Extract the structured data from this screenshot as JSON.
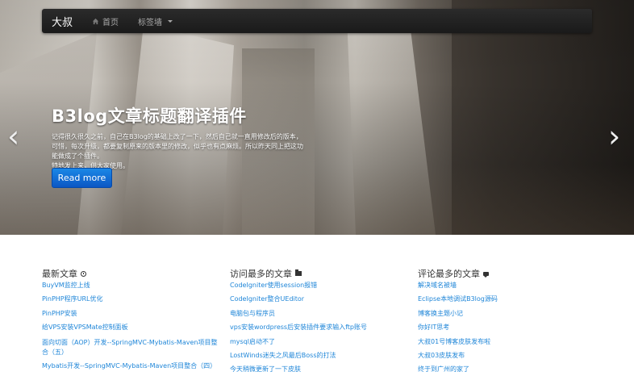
{
  "navbar": {
    "brand": "大叔",
    "items": [
      {
        "label": "首页",
        "icon": "home-icon"
      },
      {
        "label": "标签墙",
        "icon": "chevron-down-icon"
      }
    ]
  },
  "carousel": {
    "title": "B3log文章标题翻译插件",
    "description_lines": [
      "记得很久很久之前，自己在B3log的基础上改了一下，然后自己就一直用修改后的版本，",
      "可惜，每次升级，都要复制原来的版本里的修改，似乎也有点麻烦。所以昨天同上把这功",
      "能做成了个插件。",
      "特地发上来，供大家使用。"
    ],
    "read_more": "Read more",
    "prev": "‹",
    "next": "›"
  },
  "latest": {
    "heading": "最新文章",
    "items": [
      "BuyVM监控上线",
      "PinPHP程序URL优化",
      "PinPHP安装",
      "给VPS安装VPSMate控制面板",
      "面向切面（AOP）开发--SpringMVC-Mybatis-Maven项目整合（五）",
      "Mybatis开发--SpringMVC-Mybatis-Maven项目整合（四）"
    ]
  },
  "most_visited": {
    "heading": "访问最多的文章",
    "items": [
      "CodeIgniter使用session报错",
      "CodeIgniter整合UEditor",
      "电脑包与程序员",
      "vps安装wordpress后安装插件要求输入ftp账号",
      "mysql启动不了",
      "LostWinds迷失之风最后Boss的打法",
      "今天稍微更新了一下皮肤"
    ]
  },
  "most_commented": {
    "heading": "评论最多的文章",
    "items": [
      "解决域名被墙",
      "Eclipse本地调试B3log源码",
      "博客换主题小记",
      "你好IT思考",
      "大叔01号博客皮肤发布啦",
      "大叔03皮肤发布",
      "终于到广州的家了"
    ]
  },
  "colors": {
    "link": "#1f86d8",
    "button": "#0b56c4",
    "navbar": "#1a1a1a"
  }
}
